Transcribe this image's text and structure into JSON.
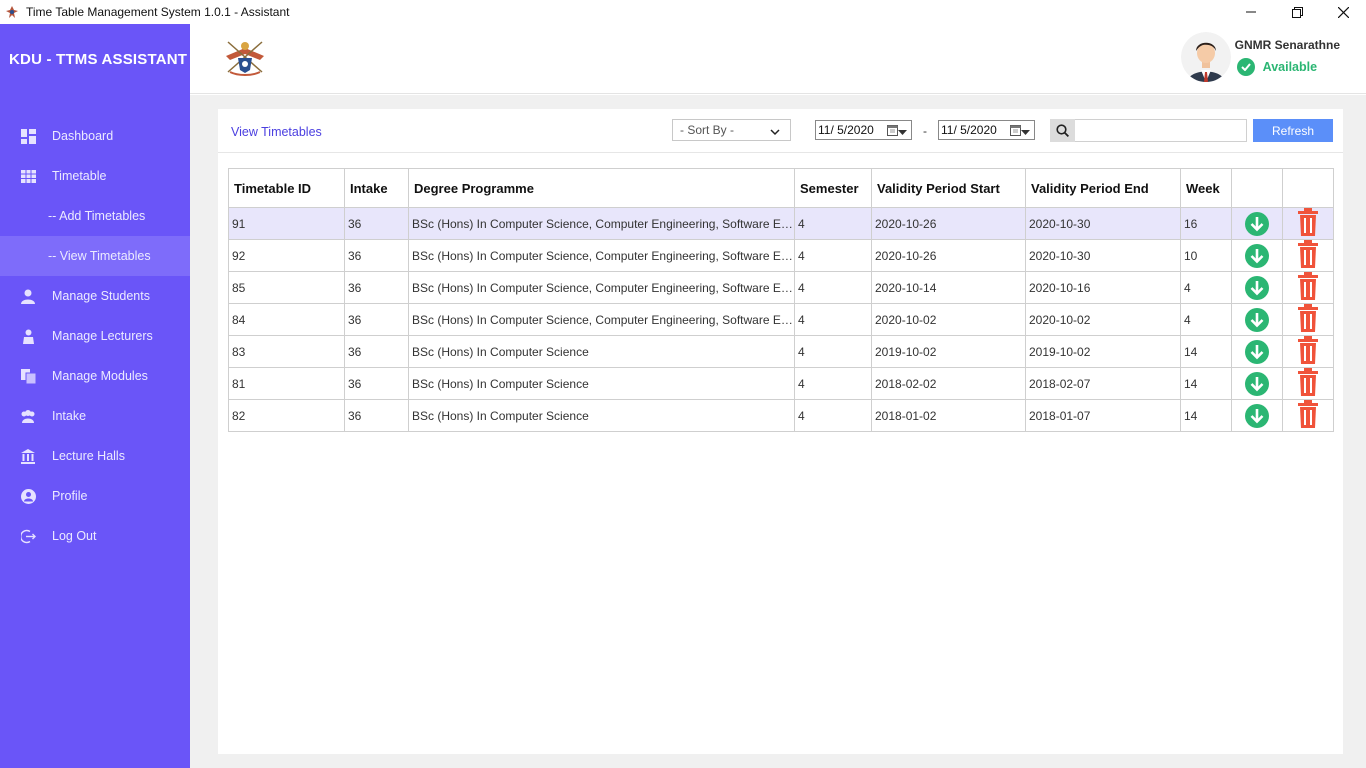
{
  "window": {
    "title": "Time Table Management System 1.0.1 - Assistant",
    "minimize_icon": "minimize-icon",
    "restore_icon": "restore-icon",
    "close_icon": "close-icon"
  },
  "sidebar": {
    "brand": "KDU - TTMS ASSISTANT",
    "accent_color": "#6a55f8",
    "items": [
      {
        "label": "Dashboard",
        "icon": "dashboard-icon"
      },
      {
        "label": "Timetable",
        "icon": "table-icon"
      },
      {
        "label": "-- Add Timetables",
        "icon": ""
      },
      {
        "label": "-- View Timetables",
        "icon": "",
        "active": true
      },
      {
        "label": "Manage Students",
        "icon": "student-icon"
      },
      {
        "label": "Manage Lecturers",
        "icon": "lecturer-icon"
      },
      {
        "label": "Manage Modules",
        "icon": "modules-icon"
      },
      {
        "label": "Intake",
        "icon": "users-icon"
      },
      {
        "label": "Lecture Halls",
        "icon": "building-icon"
      },
      {
        "label": "Profile",
        "icon": "profile-icon"
      },
      {
        "label": "Log Out",
        "icon": "logout-icon"
      }
    ]
  },
  "header": {
    "user_name": "GNMR Senarathne",
    "status": "Available",
    "status_color": "#2bb673"
  },
  "toolbar": {
    "page_title": "View Timetables",
    "sort_label": "- Sort By -",
    "date_from": "11/  5/2020",
    "date_separator": "-",
    "date_to": "11/  5/2020",
    "search_value": "",
    "refresh_label": "Refresh"
  },
  "table": {
    "columns": [
      "Timetable ID",
      "Intake",
      "Degree Programme",
      "Semester",
      "Validity Period Start",
      "Validity Period End",
      "Week",
      "",
      ""
    ],
    "rows": [
      [
        "91",
        "36",
        "BSc (Hons) In Computer Science, Computer Engineering, Software En...",
        "4",
        "2020-10-26",
        "2020-10-30",
        "16"
      ],
      [
        "92",
        "36",
        "BSc (Hons) In Computer Science, Computer Engineering, Software En...",
        "4",
        "2020-10-26",
        "2020-10-30",
        "10"
      ],
      [
        "85",
        "36",
        "BSc (Hons) In Computer Science, Computer Engineering, Software En...",
        "4",
        "2020-10-14",
        "2020-10-16",
        "4"
      ],
      [
        "84",
        "36",
        "BSc (Hons) In Computer Science, Computer Engineering, Software En...",
        "4",
        "2020-10-02",
        "2020-10-02",
        "4"
      ],
      [
        "83",
        "36",
        "BSc (Hons) In Computer Science",
        "4",
        "2019-10-02",
        "2019-10-02",
        "14"
      ],
      [
        "81",
        "36",
        "BSc (Hons) In Computer Science",
        "4",
        "2018-02-02",
        "2018-02-07",
        "14"
      ],
      [
        "82",
        "36",
        "BSc (Hons) In Computer Science",
        "4",
        "2018-01-02",
        "2018-01-07",
        "14"
      ]
    ],
    "selected_row": 0,
    "download_icon": "download-icon",
    "delete_icon": "trash-icon",
    "download_color": "#2bb673",
    "delete_color": "#f0533a"
  }
}
